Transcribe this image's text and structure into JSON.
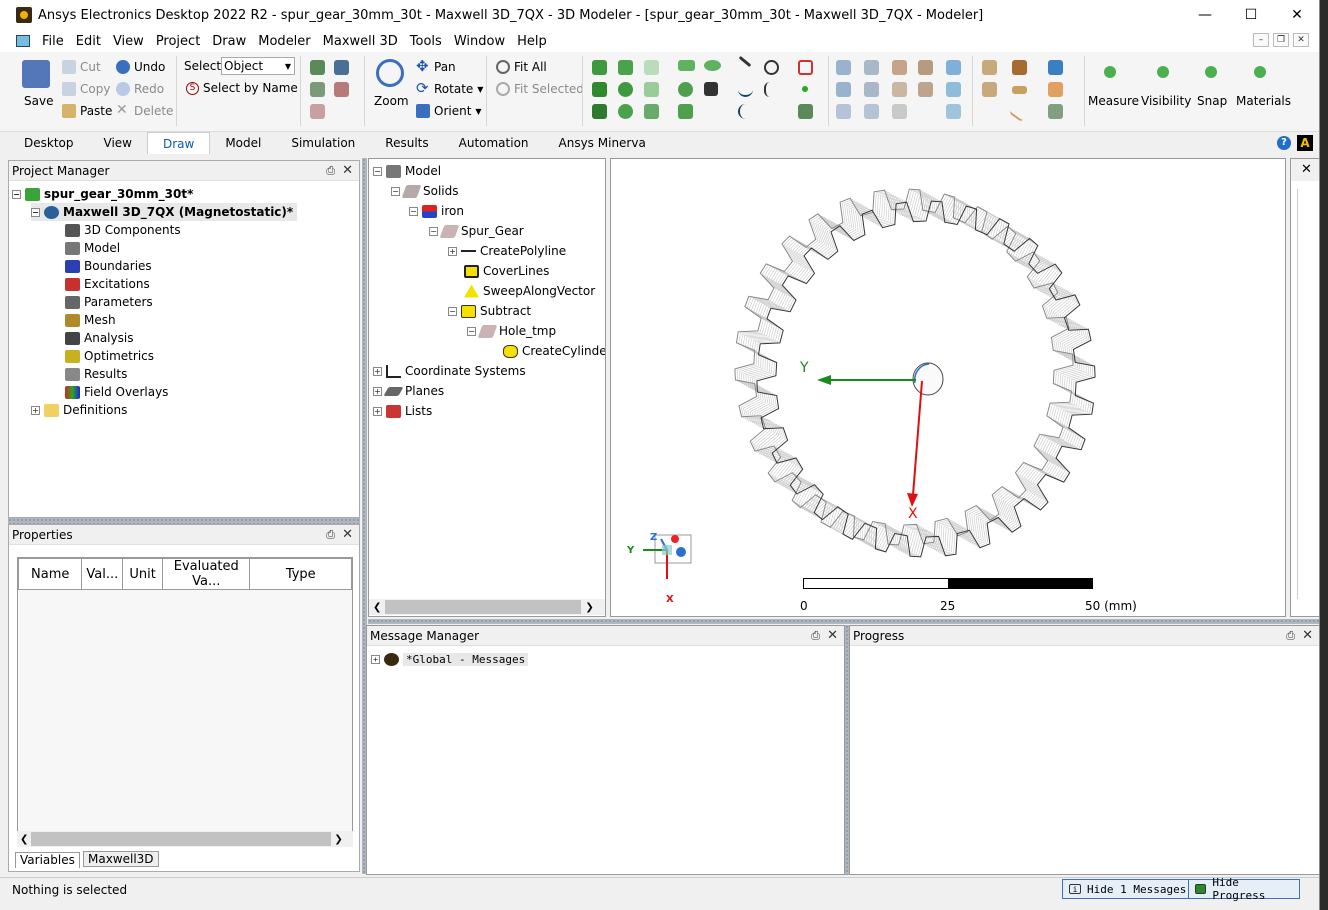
{
  "window": {
    "title": "Ansys Electronics Desktop 2022 R2 - spur_gear_30mm_30t - Maxwell 3D_7QX - 3D Modeler - [spur_gear_30mm_30t - Maxwell 3D_7QX - Modeler]"
  },
  "menu": [
    "File",
    "Edit",
    "View",
    "Project",
    "Draw",
    "Modeler",
    "Maxwell 3D",
    "Tools",
    "Window",
    "Help"
  ],
  "ribbon": {
    "save": "Save",
    "cut": "Cut",
    "copy": "Copy",
    "paste": "Paste",
    "undo": "Undo",
    "redo": "Redo",
    "delete": "Delete",
    "select_label": "Select:",
    "select_value": "Object",
    "select_by_name": "Select by Name",
    "zoom": "Zoom",
    "pan": "Pan",
    "rotate": "Rotate",
    "orient": "Orient",
    "fit_all": "Fit All",
    "fit_selected": "Fit Selected",
    "measure": "Measure",
    "visibility": "Visibility",
    "snap": "Snap",
    "materials": "Materials"
  },
  "tabs": [
    "Desktop",
    "View",
    "Draw",
    "Model",
    "Simulation",
    "Results",
    "Automation",
    "Ansys Minerva"
  ],
  "project_manager": {
    "title": "Project Manager",
    "project": "spur_gear_30mm_30t*",
    "design": "Maxwell 3D_7QX (Magnetostatic)*",
    "items": [
      "3D Components",
      "Model",
      "Boundaries",
      "Excitations",
      "Parameters",
      "Mesh",
      "Analysis",
      "Optimetrics",
      "Results",
      "Field Overlays"
    ],
    "definitions": "Definitions"
  },
  "properties": {
    "title": "Properties",
    "columns": [
      "Name",
      "Val...",
      "Unit",
      "Evaluated Va...",
      "Type"
    ],
    "tabs": [
      "Variables",
      "Maxwell3D"
    ]
  },
  "model_tree": {
    "model": "Model",
    "solids": "Solids",
    "iron": "iron",
    "spur_gear": "Spur_Gear",
    "create_polyline": "CreatePolyline",
    "cover_lines": "CoverLines",
    "sweep_along_vector": "SweepAlongVector",
    "subtract": "Subtract",
    "hole_tmp": "Hole_tmp",
    "create_cylinder": "CreateCylinder",
    "coordinate_systems": "Coordinate Systems",
    "planes": "Planes",
    "lists": "Lists"
  },
  "viewport": {
    "axis_y": "Y",
    "axis_x": "X",
    "triad_z": "Z",
    "triad_y": "Y",
    "triad_x": "X",
    "scale_0": "0",
    "scale_25": "25",
    "scale_50": "50 (mm)"
  },
  "message_manager": {
    "title": "Message Manager",
    "global": "*Global - Messages"
  },
  "progress": {
    "title": "Progress"
  },
  "status": {
    "text": "Nothing is selected",
    "hide_messages": "Hide 1 Messages",
    "hide_progress": "Hide Progress"
  }
}
